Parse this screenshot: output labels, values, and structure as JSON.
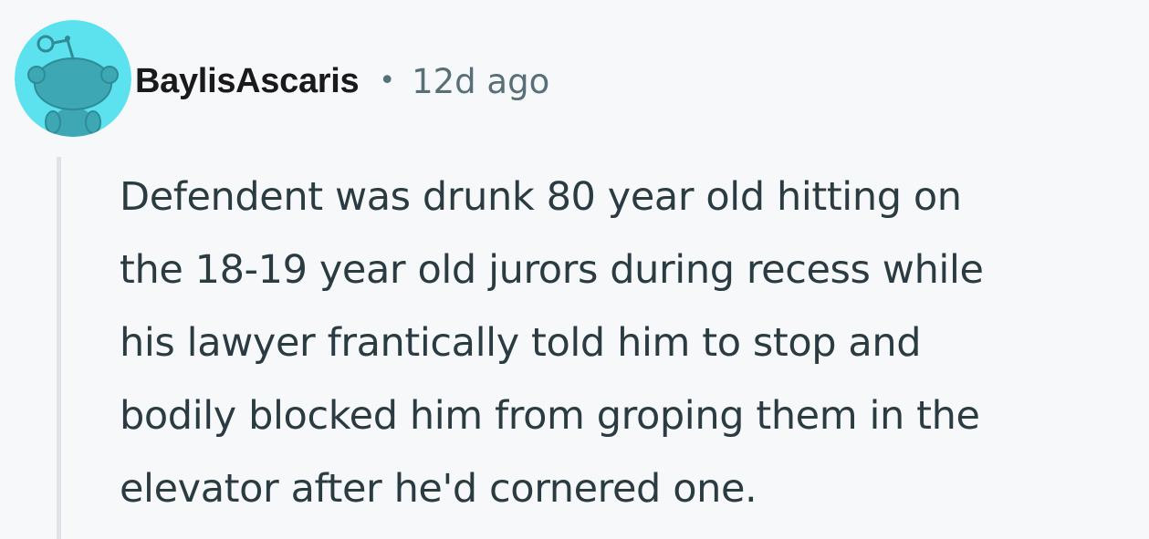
{
  "comment": {
    "author": "BaylisAscaris",
    "separator": "•",
    "age": "12d ago",
    "avatar_icon": "reddit-snoo-avatar-icon",
    "avatar_color": "#5ce1ee",
    "body_lines": [
      "Defendent was drunk 80 year old hitting on",
      "the 18-19 year old jurors during recess while",
      "his lawyer frantically told him to stop and",
      "bodily blocked him from groping them in the",
      "elevator after he'd cornered one."
    ]
  },
  "colors": {
    "background": "#f7f8fa",
    "username": "#1a1a1b",
    "meta": "#576f76",
    "body_text": "#2a3c42",
    "thread_line": "#dfe3e8"
  }
}
